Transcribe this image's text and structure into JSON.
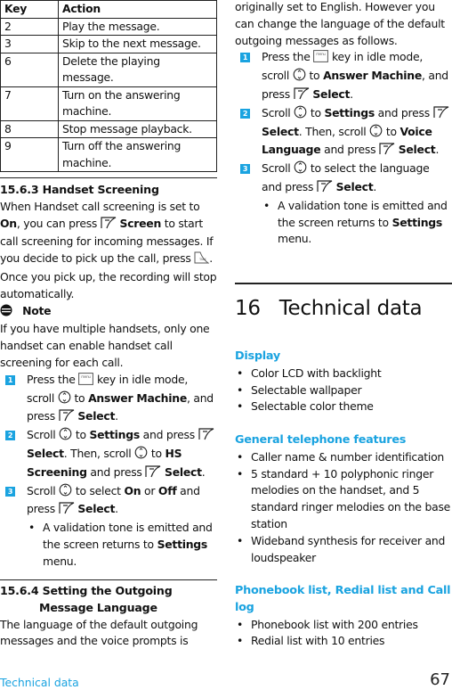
{
  "key_table": {
    "headers": [
      "Key",
      "Action"
    ],
    "rows": [
      {
        "key": "2",
        "action": "Play the message."
      },
      {
        "key": "3",
        "action": "Skip to the next message."
      },
      {
        "key": "6",
        "action": "Delete the playing message."
      },
      {
        "key": "7",
        "action": "Turn on the answering machine."
      },
      {
        "key": "8",
        "action": "Stop message playback."
      },
      {
        "key": "9",
        "action": "Turn off the answering machine."
      }
    ]
  },
  "handset_screening": {
    "title": "15.6.3 Handset Screening",
    "intro_1": "When Handset call screening is set to ",
    "intro_on": "On",
    "intro_2": ", you can press ",
    "intro_screen": "Screen",
    "intro_3": " to start call screening for incoming messages. If you decide to pick up the call, press ",
    "intro_4": ". Once you pick up, the recording will stop automatically.",
    "note_title": "Note",
    "note_text": "If you have multiple handsets, only one handset can enable handset call screening for each call.",
    "steps": [
      {
        "num": "1",
        "t1": "Press the ",
        "t2": " key in idle mode, scroll ",
        "t3": " to ",
        "b1": "Answer Machine",
        "t4": ", and press ",
        "b2": "Select",
        "t5": "."
      },
      {
        "num": "2",
        "t1": "Scroll ",
        "t2": " to ",
        "b1": "Settings",
        "t3": " and press ",
        "b2": "Select",
        "t4": ". Then, scroll ",
        "t5": " to ",
        "b3": "HS Screening",
        "t6": " and press ",
        "b4": "Select",
        "t7": "."
      },
      {
        "num": "3",
        "t1": "Scroll ",
        "t2": " to select ",
        "b1": "On",
        "t3": " or ",
        "b2": "Off",
        "t4": " and press ",
        "b3": "Select",
        "t5": "."
      }
    ],
    "bullet": {
      "t1": "A validation tone is emitted and the screen returns to ",
      "b1": "Settings",
      "t2": " menu."
    }
  },
  "outgoing_language": {
    "title_line1": "15.6.4 Setting the Outgoing",
    "title_line2": "Message Language",
    "intro_left": "The language of the default outgoing messages and the voice prompts is",
    "intro_right": "originally set to English. However you can change the language of the default outgoing messages as follows.",
    "steps": [
      {
        "num": "1",
        "t1": "Press the ",
        "t2": " key in idle mode, scroll ",
        "t3": " to ",
        "b1": "Answer Machine",
        "t4": ", and press ",
        "b2": "Select",
        "t5": "."
      },
      {
        "num": "2",
        "t1": "Scroll ",
        "t2": " to ",
        "b1": "Settings",
        "t3": " and press ",
        "b2": "Select",
        "t4": ". Then, scroll ",
        "t5": " to ",
        "b3": "Voice Language",
        "t6": " and press ",
        "b4": "Select",
        "t7": "."
      },
      {
        "num": "3",
        "t1": "Scroll ",
        "t2": " to select the language and press ",
        "b1": "Select",
        "t3": "."
      }
    ],
    "bullet": {
      "t1": "A validation tone is emitted and the screen returns to ",
      "b1": "Settings",
      "t2": " menu."
    }
  },
  "technical_data": {
    "chapter_num": "16",
    "chapter_title": "Technical data",
    "sections": [
      {
        "heading": "Display",
        "items": [
          "Color LCD with backlight",
          "Selectable wallpaper",
          "Selectable color theme"
        ]
      },
      {
        "heading": "General telephone features",
        "items": [
          "Caller name & number identification",
          "5 standard + 10 polyphonic ringer melodies on the handset, and 5 standard ringer melodies on the base station",
          "Wideband synthesis for receiver and loudspeaker"
        ]
      },
      {
        "heading": "Phonebook list, Redial list and Call log",
        "items": [
          "Phonebook list with 200 entries",
          "Redial list with 10 entries"
        ]
      }
    ]
  },
  "footer": {
    "section": "Technical data",
    "page": "67"
  },
  "colors": {
    "accent": "#1aa3e0",
    "text": "#111111"
  }
}
